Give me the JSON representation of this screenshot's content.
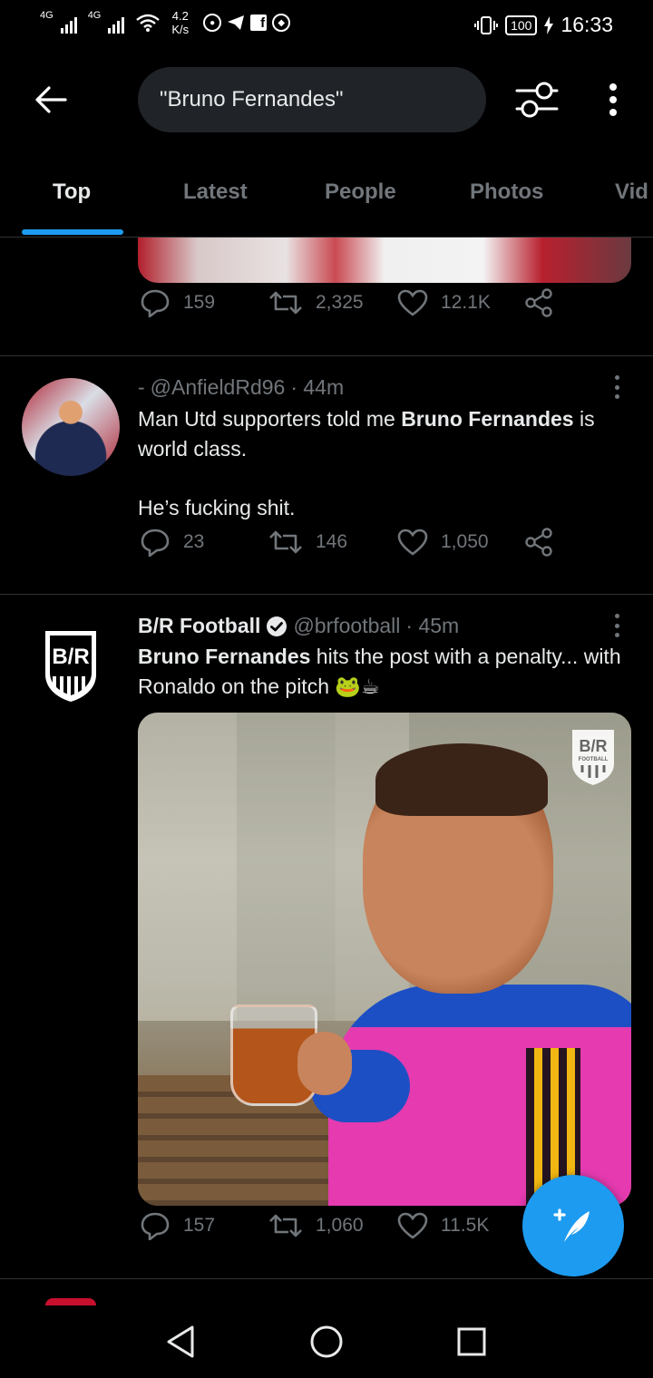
{
  "status_bar": {
    "signal1_label": "4G",
    "signal2_label": "4G",
    "speed_value": "4.2",
    "speed_unit": "K/s",
    "battery": "100",
    "time": "16:33"
  },
  "search": {
    "query": "\"Bruno Fernandes\""
  },
  "tabs": [
    {
      "label": "Top",
      "active": true
    },
    {
      "label": "Latest"
    },
    {
      "label": "People"
    },
    {
      "label": "Photos"
    },
    {
      "label": "Vid"
    }
  ],
  "tweets": [
    {
      "stats": {
        "replies": "159",
        "retweets": "2,325",
        "likes": "12.1K"
      }
    },
    {
      "name": "-",
      "handle": "@AnfieldRd96",
      "time": "· 44m",
      "text_before": "Man Utd supporters told me ",
      "text_bold": "Bruno Fernandes",
      "text_after": " is world class.",
      "text_para2": "He’s fucking shit.",
      "stats": {
        "replies": "23",
        "retweets": "146",
        "likes": "1,050"
      }
    },
    {
      "name": "B/R Football",
      "verified": true,
      "handle": "@brfootball",
      "time": "· 45m",
      "text_bold": "Bruno Fernandes",
      "text_after": " hits the post with a penalty... with Ronaldo on the pitch ",
      "emoji": "🐸☕",
      "avatar_logo": "B/R",
      "image_logo_line1": "B/R",
      "image_logo_line2": "FOOTBALL",
      "stats": {
        "replies": "157",
        "retweets": "1,060",
        "likes": "11.5K"
      }
    }
  ],
  "colors": {
    "accent": "#1d9bf0",
    "secondary_text": "#71767b",
    "divider": "#2f3336"
  }
}
